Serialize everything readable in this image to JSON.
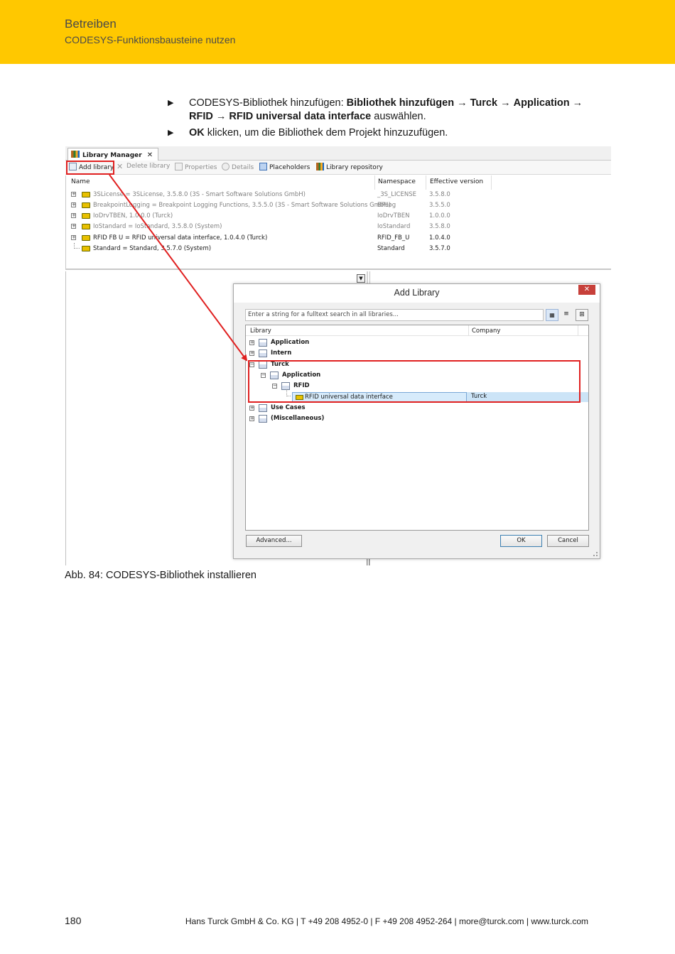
{
  "header": {
    "title": "Betreiben",
    "subtitle": "CODESYS-Funktionsbausteine nutzen"
  },
  "steps": [
    {
      "prefix": "CODESYS-Bibliothek hinzufügen: ",
      "path": [
        "Bibliothek hinzufügen",
        "Turck",
        "Application",
        "RFID",
        "RFID universal data interface"
      ],
      "arrow": "→",
      "suffix": " auswählen."
    },
    {
      "bold": "OK",
      "rest": " klicken, um die Bibliothek dem Projekt hinzuzufügen."
    }
  ],
  "library_manager": {
    "tab_title": "Library Manager",
    "toolbar": {
      "add_library": "Add library",
      "delete_library": "Delete library",
      "properties": "Properties",
      "details": "Details",
      "placeholders": "Placeholders",
      "library_repository": "Library repository"
    },
    "columns": {
      "name": "Name",
      "namespace": "Namespace",
      "effective_version": "Effective version"
    },
    "rows": [
      {
        "name": "3SLicense = 3SLicense, 3.5.8.0 (3S - Smart Software Solutions GmbH)",
        "namespace": "_3S_LICENSE",
        "version": "3.5.8.0"
      },
      {
        "name": "BreakpointLogging = Breakpoint Logging Functions, 3.5.5.0 (3S - Smart Software Solutions GmbH)",
        "namespace": "BPLog",
        "version": "3.5.5.0"
      },
      {
        "name": "IoDrvTBEN, 1.0.0.0 (Turck)",
        "namespace": "IoDrvTBEN",
        "version": "1.0.0.0"
      },
      {
        "name": "IoStandard = IoStandard, 3.5.8.0 (System)",
        "namespace": "IoStandard",
        "version": "3.5.8.0"
      },
      {
        "name": "RFID FB U = RFID universal data interface, 1.0.4.0 (Turck)",
        "namespace": "RFID_FB_U",
        "version": "1.0.4.0"
      },
      {
        "name": "Standard = Standard, 3.5.7.0 (System)",
        "namespace": "Standard",
        "version": "3.5.7.0"
      }
    ]
  },
  "add_library_dialog": {
    "title": "Add Library",
    "close_glyph": "✕",
    "search_placeholder": "Enter a string for a fulltext search in all libraries...",
    "columns": {
      "library": "Library",
      "company": "Company"
    },
    "tree": {
      "application": "Application",
      "intern": "Intern",
      "turck": "Turck",
      "turck_application": "Application",
      "rfid": "RFID",
      "rfid_item": "RFID universal data interface",
      "rfid_item_company": "Turck",
      "use_cases": "Use Cases",
      "misc": "(Miscellaneous)"
    },
    "buttons": {
      "advanced": "Advanced...",
      "ok": "OK",
      "cancel": "Cancel"
    }
  },
  "caption": "Abb. 84: CODESYS-Bibliothek installieren",
  "page_number": "180",
  "footer": "Hans Turck GmbH & Co. KG | T +49 208 4952-0 | F +49 208 4952-264 | more@turck.com | www.turck.com",
  "colors": {
    "header_band": "#ffc800",
    "highlight": "#e02020",
    "selection": "#cce4f7"
  }
}
